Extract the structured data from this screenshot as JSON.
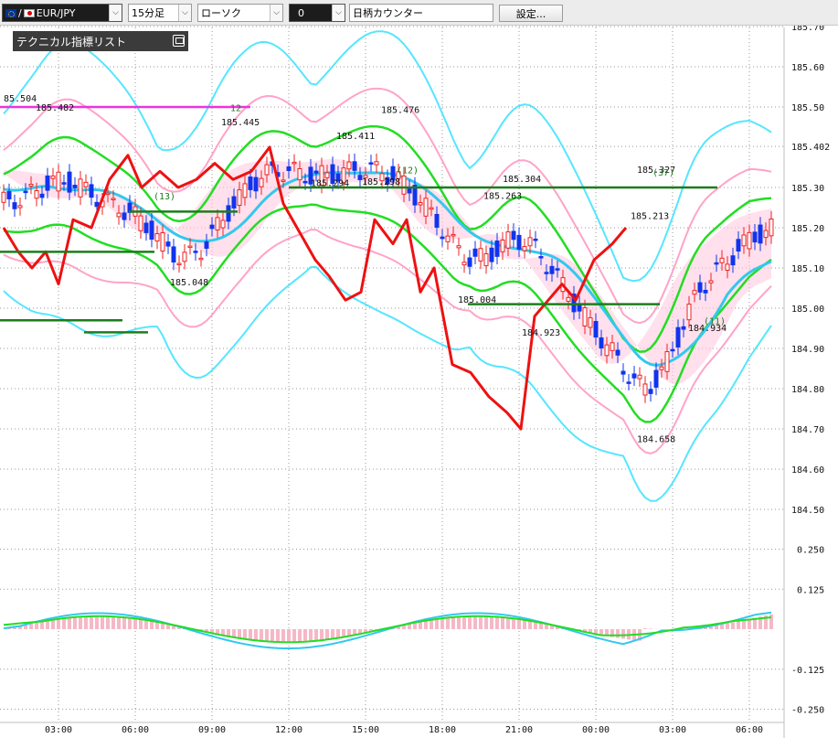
{
  "toolbar": {
    "symbol": "EUR/JPY",
    "timeframe": "15分足",
    "chart_style": "ローソク",
    "counter_value": "0",
    "counter_label": "日柄カウンター",
    "settings_label": "設定..."
  },
  "panel": {
    "title": "テクニカル指標リスト"
  },
  "colors": {
    "price_line": "#ee1111",
    "bollinger_outer": "#55e6ff",
    "bollinger_inner": "#ffa3c8",
    "middle_band": "#22dd22",
    "moving_average": "#33c8ee",
    "ichimoku_cloud": "#ffc6dc",
    "support_resistance": "#1b7d1b",
    "high_line": "#ee33dd",
    "candle_up": "#ee2222",
    "candle_down": "#1133ee"
  },
  "chart_data": {
    "type": "line",
    "instrument": "EUR/JPY",
    "timeframe": "15分足",
    "y_ticks": [
      "185.70",
      "185.60",
      "185.50",
      "185.402",
      "185.30",
      "185.20",
      "185.10",
      "185.00",
      "184.90",
      "184.80",
      "184.70",
      "184.60",
      "184.50"
    ],
    "osc_ticks": [
      "0.250",
      "0.125",
      "-0.125",
      "-0.250"
    ],
    "x_ticks": [
      "03:00",
      "06:00",
      "09:00",
      "12:00",
      "15:00",
      "18:00",
      "21:00",
      "00:00",
      "03:00",
      "06:00"
    ],
    "price_annotations": [
      {
        "label": "85.504",
        "x": "01:30",
        "y": 185.504
      },
      {
        "label": "185.482",
        "x": "02:45",
        "y": 185.482
      },
      {
        "label": "185.327",
        "x": "02:15",
        "y": 185.327
      },
      {
        "label": "185.445",
        "x": "10:00",
        "y": 185.445
      },
      {
        "label": "185.048",
        "x": "08:00",
        "y": 185.048
      },
      {
        "label": "185.294",
        "x": "13:30",
        "y": 185.294
      },
      {
        "label": "185.411",
        "x": "14:30",
        "y": 185.411
      },
      {
        "label": "185.298",
        "x": "15:30",
        "y": 185.298
      },
      {
        "label": "185.476",
        "x": "16:15",
        "y": 185.476
      },
      {
        "label": "185.263",
        "x": "20:15",
        "y": 185.263
      },
      {
        "label": "185.304",
        "x": "21:00",
        "y": 185.304
      },
      {
        "label": "185.004",
        "x": "19:15",
        "y": 185.004
      },
      {
        "label": "184.923",
        "x": "21:45",
        "y": 184.923
      },
      {
        "label": "185.213",
        "x": "02:00",
        "y": 185.213
      },
      {
        "label": "184.658",
        "x": "02:15",
        "y": 184.658
      },
      {
        "label": "184.934",
        "x": "04:15",
        "y": 184.934
      }
    ],
    "counters": [
      {
        "label": "(13)",
        "x": "07:00",
        "y": 185.27
      },
      {
        "label": "12",
        "x": "10:00",
        "y": 185.49
      },
      {
        "label": "(12)",
        "x": "16:30",
        "y": 185.335
      },
      {
        "label": "(37)",
        "x": "02:30",
        "y": 185.33
      },
      {
        "label": "(11)",
        "x": "04:30",
        "y": 184.96
      }
    ],
    "horizontal_levels": [
      {
        "y": 185.5,
        "from": "00:30",
        "to": "10:30",
        "style": "high_line"
      },
      {
        "y": 185.14,
        "from": "00:00",
        "to": "06:45",
        "style": "support_resistance"
      },
      {
        "y": 185.24,
        "from": "05:45",
        "to": "10:00",
        "style": "support_resistance"
      },
      {
        "y": 184.97,
        "from": "00:00",
        "to": "05:30",
        "style": "support_resistance"
      },
      {
        "y": 185.3,
        "from": "12:00",
        "to": "04:45",
        "style": "support_resistance"
      },
      {
        "y": 185.01,
        "from": "19:00",
        "to": "02:30",
        "style": "support_resistance"
      },
      {
        "y": 184.94,
        "from": "04:00",
        "to": "06:30",
        "style": "support_resistance"
      }
    ]
  }
}
